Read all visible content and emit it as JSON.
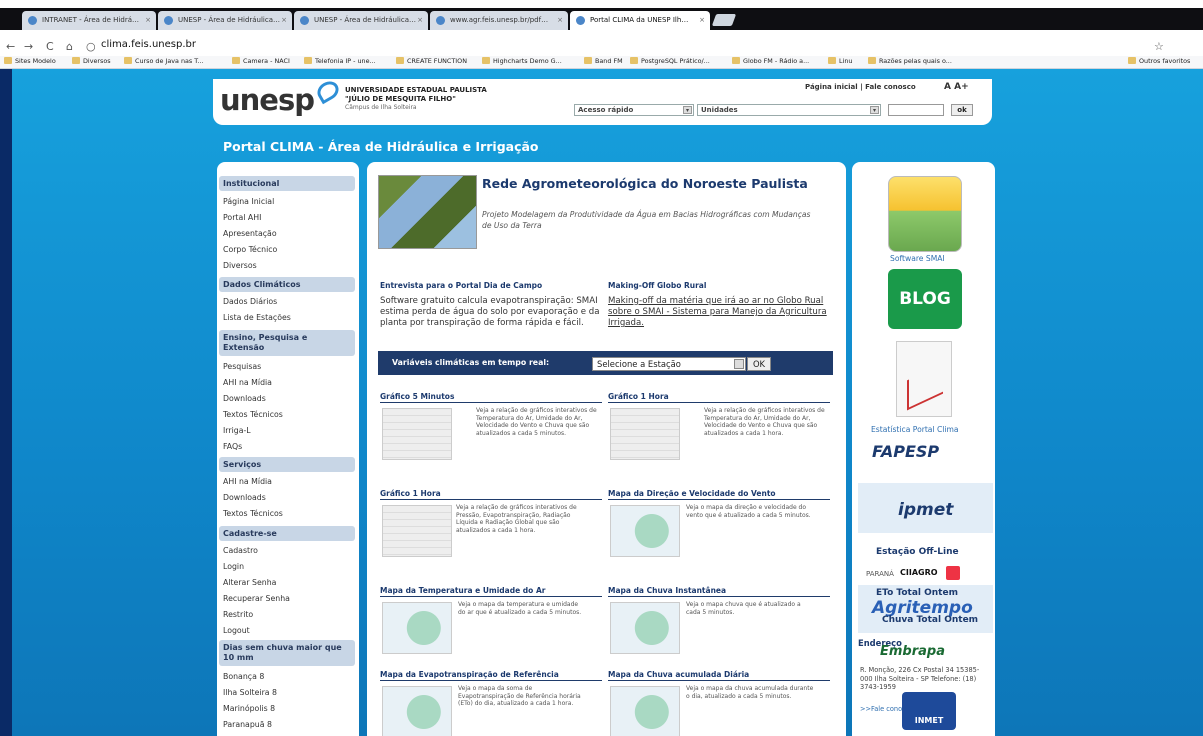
{
  "browser": {
    "tabs": [
      {
        "label": "INTRANET - Área de Hidrá…"
      },
      {
        "label": "UNESP - Área de Hidráulica…"
      },
      {
        "label": "UNESP - Área de Hidráulica…"
      },
      {
        "label": "www.agr.feis.unesp.br/pdf…"
      },
      {
        "label": "Portal CLIMA da UNESP Ilh…"
      }
    ],
    "url": "clima.feis.unesp.br",
    "bookmarks": [
      "Sites Modelo",
      "Diversos",
      "Curso de Java nas T...",
      "Camera - NACI",
      "Telefonia IP - une...",
      "CREATE FUNCTION",
      "Highcharts Demo G...",
      "Band FM",
      "PostgreSQL Prático/...",
      "Globo FM - Rádio a...",
      "Linu",
      "Razões pelas quais o...",
      "Outros favoritos"
    ]
  },
  "header": {
    "logo": "unesp",
    "inst_line1": "UNIVERSIDADE ESTADUAL PAULISTA",
    "inst_line2": "\"JÚLIO DE MESQUITA FILHO\"",
    "inst_line3": "Câmpus de Ilha Solteira",
    "top_links": "Página inicial | Fale conosco",
    "font_size": "A A+",
    "select1": "Acesso rápido",
    "select2": "Unidades",
    "ok": "ok"
  },
  "page_title": "Portal CLIMA - Área de Hidráulica e Irrigação",
  "sidebar": {
    "institucional": {
      "title": "Institucional",
      "items": [
        "Página Inicial",
        "Portal AHI",
        "Apresentação",
        "Corpo Técnico",
        "Diversos"
      ]
    },
    "dados": {
      "title": "Dados Climáticos",
      "items": [
        "Dados Diários",
        "Lista de Estações"
      ]
    },
    "ensino": {
      "title": "Ensino, Pesquisa e Extensão",
      "items": [
        "Pesquisas",
        "AHI na Mídia",
        "Downloads",
        "Textos Técnicos",
        "Irriga-L",
        "FAQs"
      ]
    },
    "servicos": {
      "title": "Serviços",
      "items": [
        "AHI na Mídia",
        "Downloads",
        "Textos Técnicos"
      ]
    },
    "cadastre": {
      "title": "Cadastre-se",
      "items": [
        "Cadastro",
        "Login",
        "Alterar Senha",
        "Recuperar Senha",
        "Restrito",
        "Logout"
      ]
    },
    "dias": {
      "title": "Dias sem chuva maior que 10 mm",
      "items": [
        "Bonança 8",
        "Ilha Solteira 8",
        "Marinópolis 8",
        "Paranapuã 8"
      ]
    }
  },
  "main": {
    "rede_title": "Rede Agrometeorológica do Noroeste Paulista",
    "rede_sub": "Projeto Modelagem da Produtividade da Água em Bacias Hidrográficas com Mudanças de Uso da Terra",
    "art1_h": "Entrevista para o Portal Dia de Campo",
    "art1_t": "Software gratuito calcula evapotranspiração: SMAI estima perda de água do solo por evaporação e da planta por transpiração de forma rápida e fácil.",
    "art2_h": "Making-Off Globo Rural",
    "art2_t": "Making-off da matéria que irá ao ar no Globo Rual sobre o SMAI - Sistema para Manejo da Agricultura Irrigada.",
    "var_label": "Variáveis climáticas em tempo real:",
    "var_select": "Selecione a Estação",
    "var_ok": "OK",
    "sections": [
      {
        "title": "Gráfico 5 Minutos",
        "text": "Veja a relação de gráficos interativos de Temperatura do Ar, Umidade do Ar, Velocidade do Vento e Chuva que são atualizados a cada 5 minutos."
      },
      {
        "title": "Gráfico 1 Hora",
        "text": "Veja a relação de gráficos interativos de Temperatura do Ar, Umidade do Ar, Velocidade do Vento e Chuva que são atualizados a cada 1 hora."
      },
      {
        "title": "Gráfico 1 Hora",
        "text": "Veja a relação de gráficos interativos de Pressão, Evapotranspiração, Radiação Líquida e Radiação Global que são atualizados a cada 1 hora."
      },
      {
        "title": "Mapa da Direção e Velocidade do Vento",
        "text": "Veja o mapa da direção e velocidade do vento que é atualizado a cada 5 minutos."
      },
      {
        "title": "Mapa da Temperatura e Umidade do Ar",
        "text": "Veja o mapa da temperatura e umidade do ar que é atualizado a cada 5 minutos."
      },
      {
        "title": "Mapa da Chuva Instantânea",
        "text": "Veja o mapa chuva que é atualizado a cada 5 minutos."
      },
      {
        "title": "Mapa da Evapotranspiração de Referência",
        "text": "Veja o mapa da soma de Evapotranspiração de Referência horária (ETo) do dia, atualizado a cada 1 hora."
      },
      {
        "title": "Mapa da Chuva acumulada Diária",
        "text": "Veja o mapa da chuva acumulada durante o dia, atualizado a cada 5 minutos."
      }
    ]
  },
  "right": {
    "smai": "Software SMAI",
    "blog": "BLOG",
    "stat": "Estatística Portal Clima",
    "fapesp": "FAPESP",
    "ipmet": "ipmet",
    "estacao": "Estação Off-Line",
    "parana": "PARANÁ",
    "ciiagro": "CIIAGRO",
    "eto1": "ETo Total Ontem",
    "agritempo": "Agritempo",
    "eto2": "Chuva Total Ontem",
    "endereco": "Endereço",
    "embrapa": "Embrapa",
    "addr": "R. Monção, 226 Cx Postal 34 15385-000 Ilha Solteira - SP Telefone: (18) 3743-1959",
    "falec": ">>Fale conosco",
    "inmet": "INMET"
  }
}
